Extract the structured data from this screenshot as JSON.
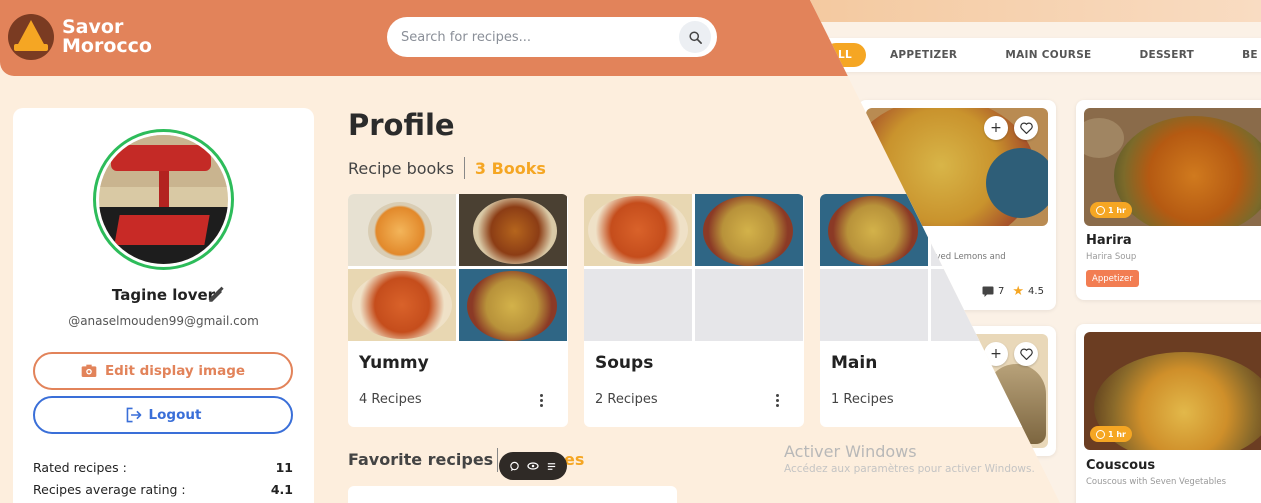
{
  "app": {
    "brand_line1": "Savor",
    "brand_line2": "Morocco"
  },
  "search": {
    "placeholder": "Search for recipes..."
  },
  "categories": [
    "LL",
    "APPETIZER",
    "MAIN COURSE",
    "DESSERT",
    "BE"
  ],
  "profile": {
    "username": "Tagine lover",
    "email": "@anaselmouden99@gmail.com",
    "edit_image_label": "Edit display image",
    "logout_label": "Logout",
    "stats": [
      {
        "label": "Rated recipes :",
        "value": "11"
      },
      {
        "label": "Recipes average rating :",
        "value": "4.1"
      }
    ]
  },
  "main": {
    "title": "Profile",
    "books_label": "Recipe books",
    "books_count": "3 Books",
    "books": [
      {
        "name": "Yummy",
        "count": "4 Recipes"
      },
      {
        "name": "Soups",
        "count": "2 Recipes"
      },
      {
        "name": "Main",
        "count": "1 Recipes"
      }
    ],
    "favorites_label": "Favorite recipes",
    "favorites_count": "es"
  },
  "background_recipes": [
    {
      "title": "",
      "subtitle": "rved Lemons and",
      "comments": "7",
      "rating": "4.5"
    },
    {
      "title": "Harira",
      "subtitle": "Harira Soup",
      "time": "1 hr",
      "tag": "Appetizer"
    },
    {
      "title": "Couscous",
      "subtitle": "Couscous with Seven Vegetables",
      "time": "1 hr"
    }
  ],
  "watermark": {
    "line1": "Activer Windows",
    "line2": "Accédez aux paramètres pour activer Windows."
  },
  "colors": {
    "header": "#e2835a",
    "accent_orange": "#f5a623",
    "logout_blue": "#3a6fd8",
    "avatar_ring": "#2dbc5a",
    "page_bg": "#fdeedd"
  }
}
